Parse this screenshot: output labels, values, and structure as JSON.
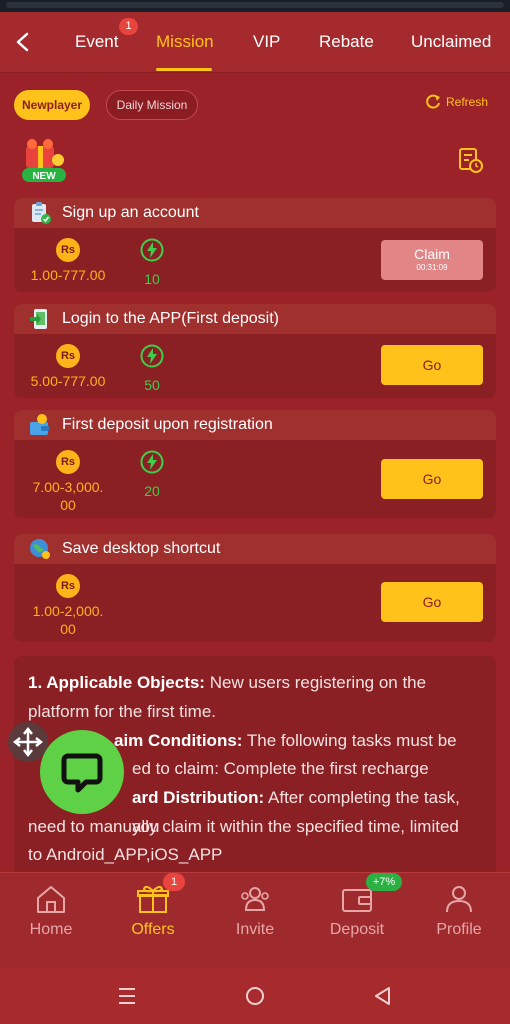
{
  "topnav": {
    "tabs": [
      {
        "label": "Event",
        "badge": "1"
      },
      {
        "label": "Mission"
      },
      {
        "label": "VIP"
      },
      {
        "label": "Rebate"
      },
      {
        "label": "Unclaimed"
      }
    ],
    "active_tab": "Mission"
  },
  "filters": {
    "newplayer": "Newplayer",
    "daily": "Daily Mission",
    "refresh": "Refresh"
  },
  "new_badge": "NEW",
  "missions": [
    {
      "title": "Sign up an account",
      "amount": "1.00-777.00",
      "points": "10",
      "action": "Claim",
      "timer": "00:31:09"
    },
    {
      "title": "Login to the APP(First deposit)",
      "amount": "5.00-777.00",
      "points": "50",
      "action": "Go"
    },
    {
      "title": "First deposit upon registration",
      "amount_line1": "7.00-3,000.",
      "amount_line2": "00",
      "points": "20",
      "action": "Go"
    },
    {
      "title": "Save desktop shortcut",
      "amount_line1": "1.00-2,000.",
      "amount_line2": "00",
      "action": "Go"
    }
  ],
  "coin_label": "Rs",
  "rules": {
    "l1_bold": "1. Applicable Objects:",
    "l1_rest": " New users registering on the",
    "l2": "platform for the first time.",
    "l3_bold": "aim Conditions:",
    "l3_rest": " The following tasks must be",
    "l4": "ed to claim: Complete the first recharge",
    "l5_bold": "ard Distribution:",
    "l5_rest": " After completing the task, you",
    "l6": "need to manually claim it within the specified time, limited",
    "l7": "to Android_APP,iOS_APP"
  },
  "bottomnav": {
    "items": [
      {
        "label": "Home"
      },
      {
        "label": "Offers",
        "badge": "1"
      },
      {
        "label": "Invite"
      },
      {
        "label": "Deposit",
        "badge": "+7%"
      },
      {
        "label": "Profile"
      }
    ],
    "active": "Offers"
  },
  "colors": {
    "accent": "#ffc21a",
    "background": "#9b2228",
    "card": "#8a1f24",
    "green": "#3fce4b"
  }
}
